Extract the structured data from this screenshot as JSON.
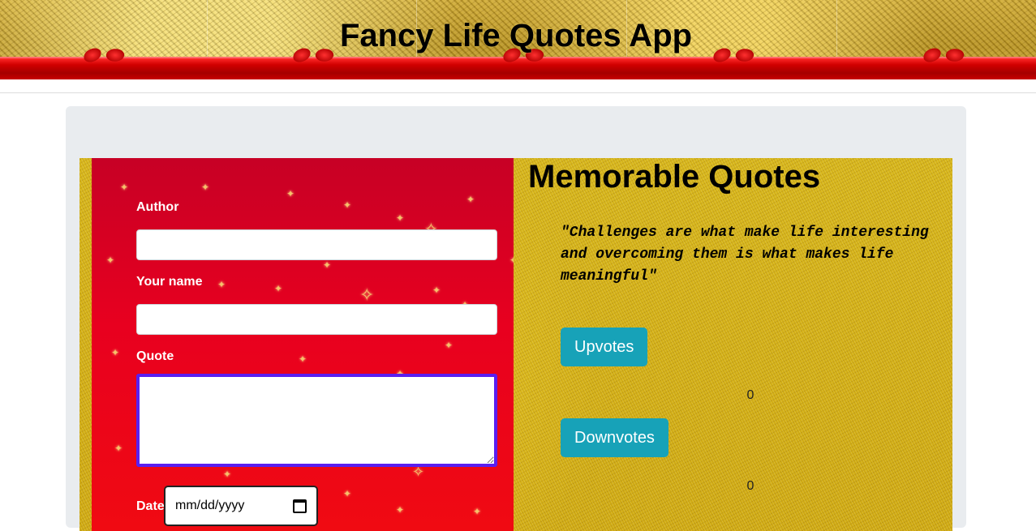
{
  "header": {
    "title": "Fancy Life Quotes App"
  },
  "form": {
    "author_label": "Author",
    "author_value": "",
    "name_label": "Your name",
    "name_value": "",
    "quote_label": "Quote",
    "quote_value": "",
    "date_label": "Date",
    "date_placeholder": "mm/dd/yyyy"
  },
  "quotes": {
    "heading": "Memorable Quotes",
    "items": [
      {
        "text": "\"Challenges are what make life interesting and overcoming them is what makes life meaningful\"",
        "upvote_label": "Upvotes",
        "upvote_count": "0",
        "downvote_label": "Downvotes",
        "downvote_count": "0"
      }
    ]
  },
  "colors": {
    "form_panel": "#e8001f",
    "focus_border": "#5a1ff0",
    "button": "#17a2b8",
    "glitter": "#d6b419"
  },
  "icons": {
    "date_picker": "calendar-icon"
  }
}
